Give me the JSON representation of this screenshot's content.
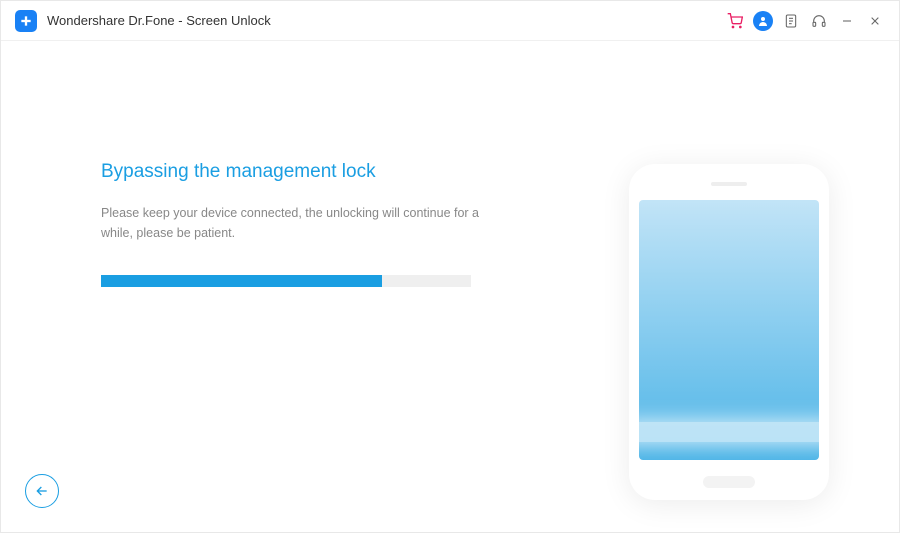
{
  "window_title": "Wondershare Dr.Fone - Screen Unlock",
  "heading": "Bypassing the management lock",
  "subtext": "Please keep your device connected, the unlocking will continue for a while, please be patient.",
  "progress_percent": 76,
  "colors": {
    "accent": "#1a9ee2",
    "logo_bg": "#1981f5",
    "cart": "#e91e63"
  }
}
